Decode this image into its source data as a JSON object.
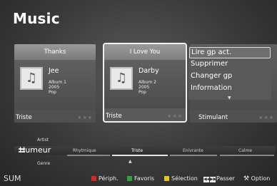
{
  "header": {
    "title": "Music"
  },
  "cards": [
    {
      "header": "Thanks",
      "artist": "Jee",
      "album": "Album 1",
      "year": "2005",
      "genre": "Pop",
      "mood": "Triste",
      "stars": "★★★"
    },
    {
      "header": "I Love You",
      "artist": "Darby",
      "album": "Album 2",
      "year": "2005",
      "genre": "Pop",
      "mood": "Triste",
      "stars": "★★★"
    },
    {
      "mood": "Stimulant",
      "stars": "★★★"
    }
  ],
  "context_menu": {
    "items": [
      "Lire gp act.",
      "Supprimer",
      "Changer gp",
      "Information"
    ],
    "more_arrow": "▼"
  },
  "sort": {
    "above_label": "Artist",
    "current": "Humeur",
    "below_label": "Genre",
    "options": [
      "Rhytmique",
      "Triste",
      "Enivrante",
      "Calme"
    ],
    "active_option": "Triste",
    "caret": "▲"
  },
  "bottom_bar": {
    "device": "SUM",
    "periph_label": "Périph.",
    "favoris_label": "Favoris",
    "selection_label": "Sélection",
    "passer_label": "Passer",
    "option_label": "Option",
    "colors": {
      "red": "#d22a2a",
      "green": "#2fa43a",
      "yellow": "#e9c31a",
      "blue": "#2a63c9"
    }
  },
  "icons": {
    "music_note": "music-note-icon",
    "tools": "tools-icon"
  }
}
